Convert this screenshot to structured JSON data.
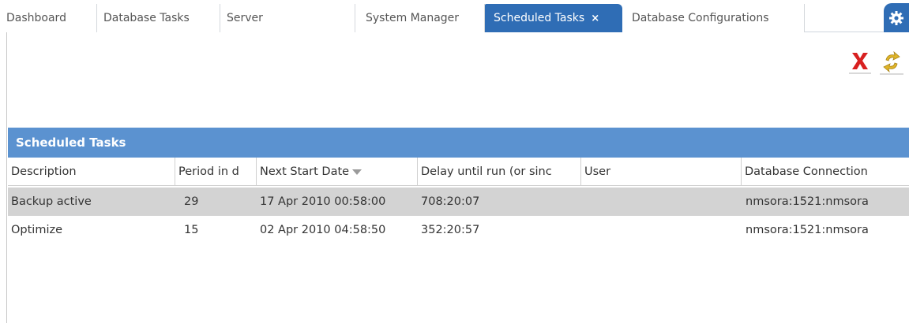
{
  "tabs": [
    {
      "label": "Dashboard"
    },
    {
      "label": "Database Tasks"
    },
    {
      "label": "Server"
    },
    {
      "label": "System Manager"
    },
    {
      "label": "Scheduled Tasks",
      "close": "×"
    },
    {
      "label": "Database Configurations"
    }
  ],
  "toolbar": {
    "delete_icon": "delete-x-icon",
    "refresh_icon": "refresh-icon"
  },
  "grid": {
    "title": "Scheduled Tasks",
    "columns": [
      "Description",
      "Period in d",
      "Next Start Date",
      "Delay until run (or sinc",
      "User",
      "Database Connection"
    ],
    "rows": [
      {
        "description": "Backup active",
        "period": "29",
        "next_start": "17 Apr 2010 00:58:00",
        "delay": "708:20:07",
        "user": "",
        "connection": "nmsora:1521:nmsora"
      },
      {
        "description": "Optimize",
        "period": "15",
        "next_start": "02 Apr 2010 04:58:50",
        "delay": "352:20:57",
        "user": "",
        "connection": "nmsora:1521:nmsora"
      }
    ]
  },
  "colors": {
    "tab_active": "#2f6db5",
    "grid_title": "#5b92d0",
    "row_selected": "#d3d3d3",
    "delete_red": "#d82020"
  }
}
